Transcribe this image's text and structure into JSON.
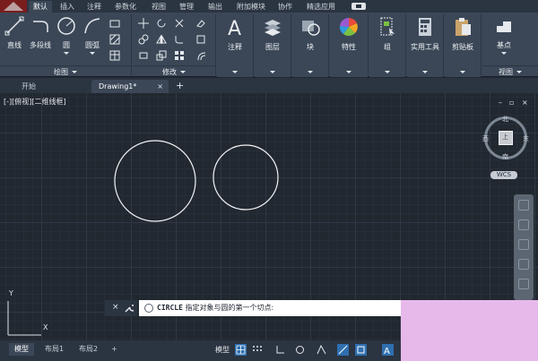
{
  "ribbon_tabs": [
    "默认",
    "插入",
    "注释",
    "参数化",
    "视图",
    "管理",
    "输出",
    "附加模块",
    "协作",
    "精选应用"
  ],
  "active_ribbon_tab": "默认",
  "draw_panel": {
    "title": "绘图",
    "tools": [
      "直线",
      "多段线",
      "圆",
      "圆弧"
    ]
  },
  "modify_panel": {
    "title": "修改"
  },
  "big_panels": [
    "注释",
    "图层",
    "块",
    "特性",
    "组",
    "实用工具",
    "剪贴板"
  ],
  "view_panel": {
    "tool": "基点",
    "title": "视图"
  },
  "file_tabs": [
    {
      "label": "开始"
    },
    {
      "label": "Drawing1*",
      "close": "×"
    }
  ],
  "new_tab": "+",
  "viewport_label": "[-][俯视][二维线框]",
  "window_controls": [
    "–",
    "▫",
    "×"
  ],
  "viewcube": {
    "north": "北",
    "south": "南",
    "east": "东",
    "west": "西",
    "top": "上",
    "coord": "WCS"
  },
  "ucs": {
    "x": "X",
    "y": "Y"
  },
  "command_line": {
    "close": "×",
    "keyword": "CIRCLE",
    "prompt": "指定对象与圆的第一个切点:"
  },
  "layout_tabs": [
    "模型",
    "布局1",
    "布局2"
  ],
  "layout_add": "+",
  "status": {
    "model": "模型"
  },
  "colors": {
    "ribbon": "#3b4757",
    "tabbar": "#2b3441",
    "canvas": "#212830",
    "status_active": "#2f6fb0",
    "side_block": "#e7b9ea"
  }
}
